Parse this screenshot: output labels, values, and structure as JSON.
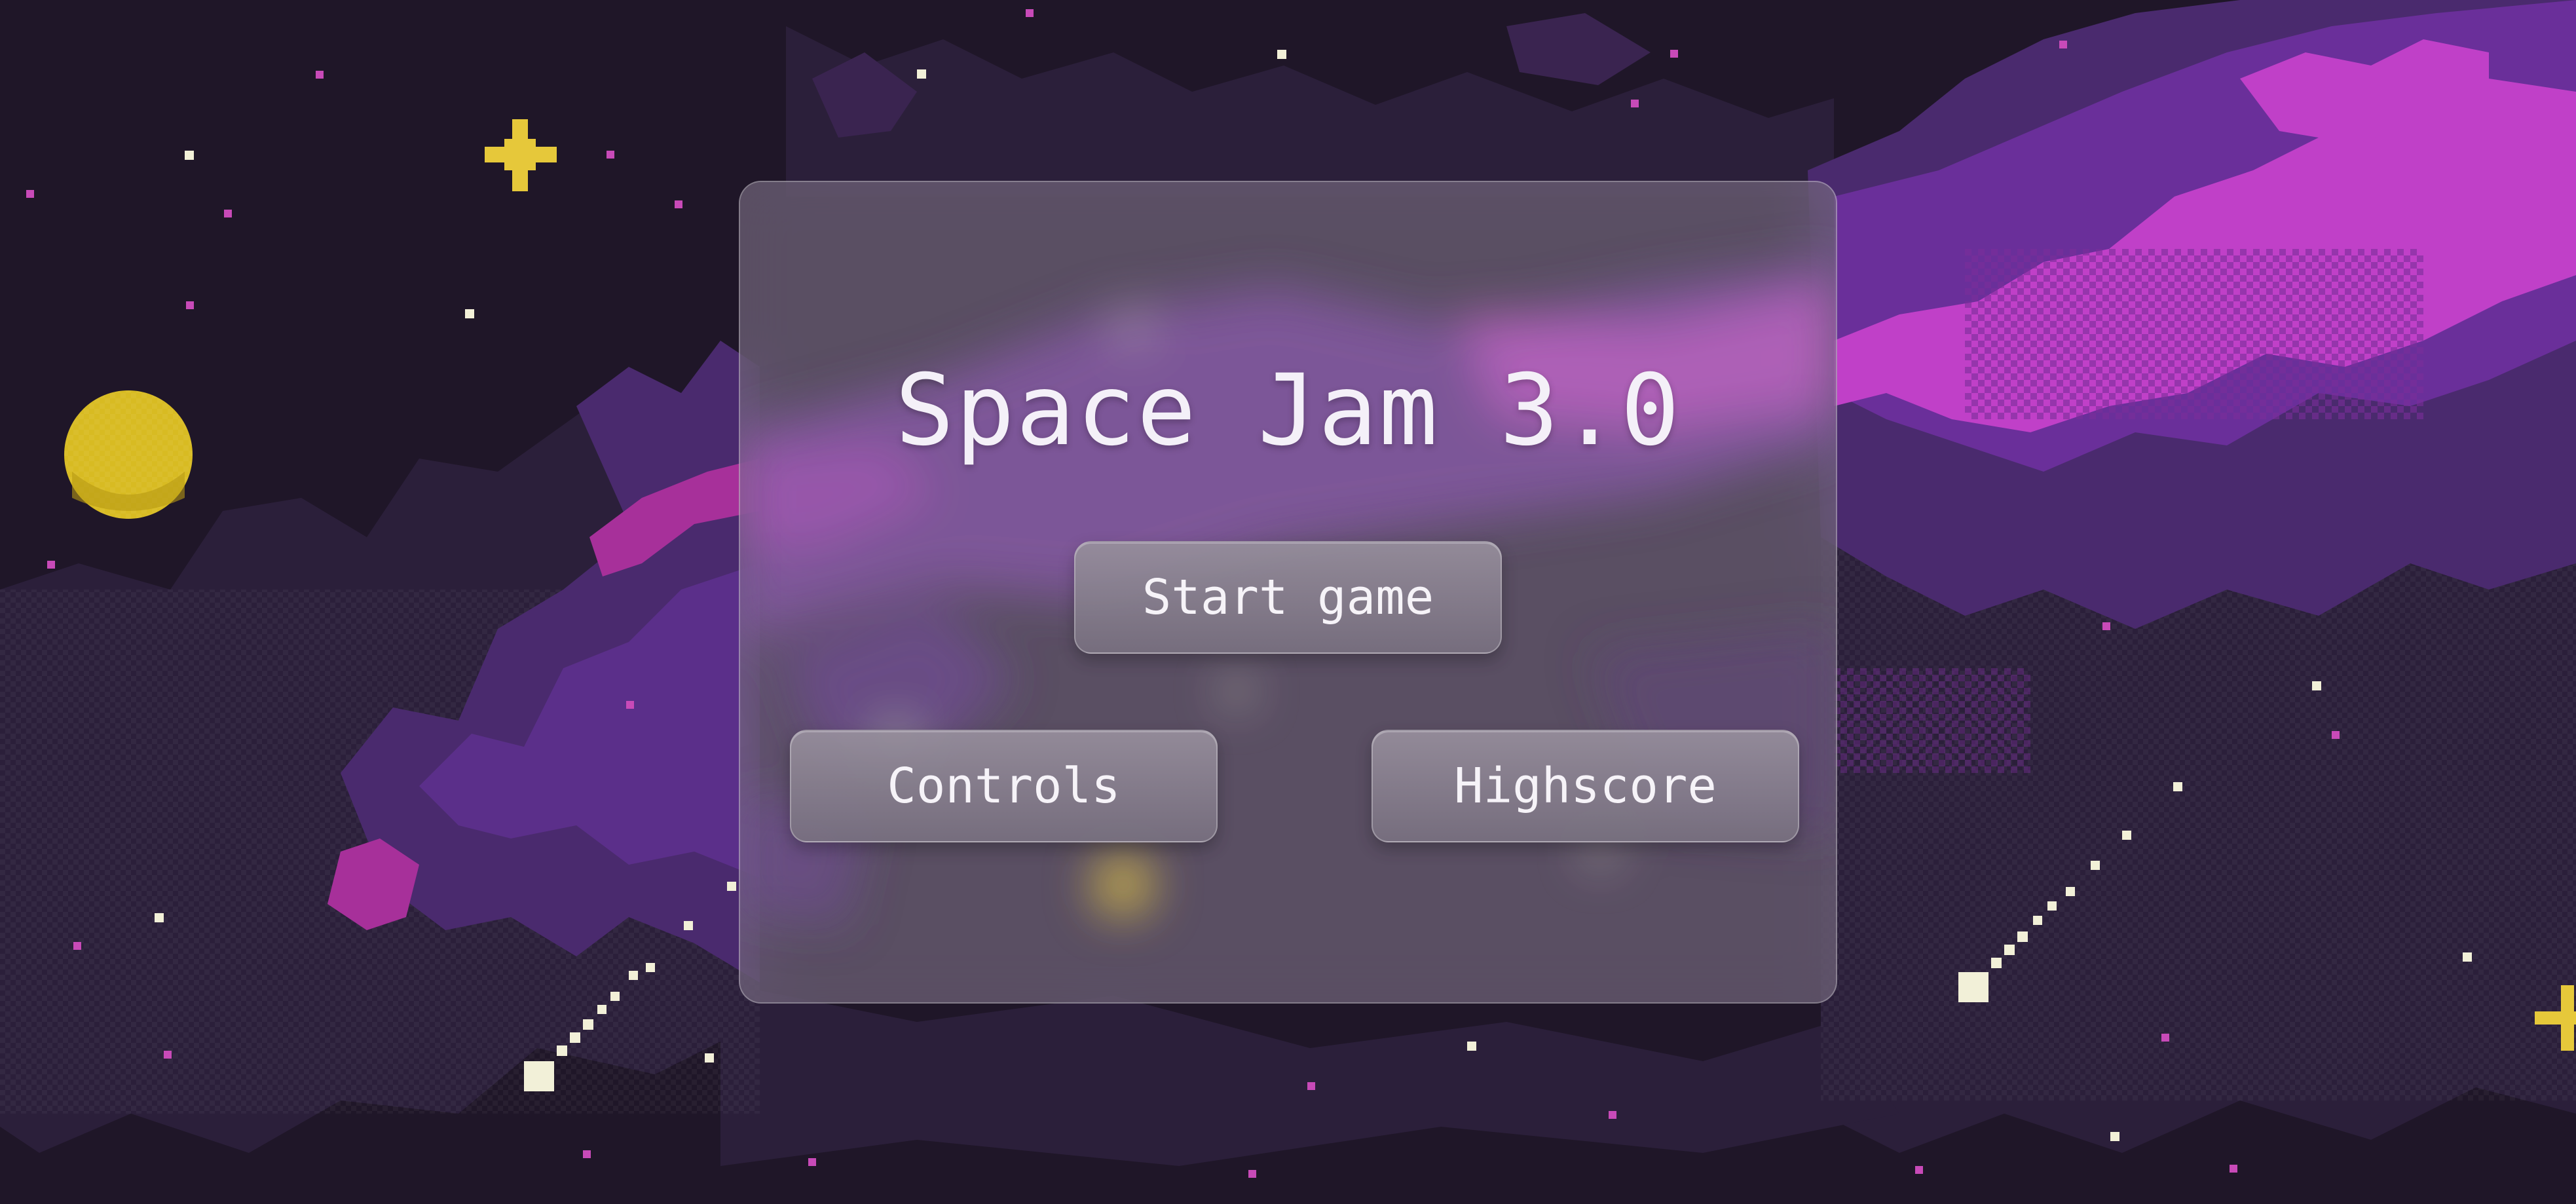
{
  "game": {
    "title": "Space Jam 3.0"
  },
  "menu": {
    "start_label": "Start game",
    "controls_label": "Controls",
    "highscore_label": "Highscore"
  },
  "colors": {
    "space_background": "#1f1628",
    "nebula_dark": "#2b1f3a",
    "nebula_purple": "#4a2a6e",
    "nebula_violet": "#5b2f8a",
    "nebula_magenta": "#c040c8",
    "planet_yellow": "#e0c430",
    "star_white": "#f2f0d8",
    "star_pink": "#c84ab8",
    "button_text": "#f6f3f8"
  },
  "icons": {
    "planet": "yellow-planet-icon",
    "sparkle": "sparkle-star-icon",
    "comet": "comet-icon"
  }
}
